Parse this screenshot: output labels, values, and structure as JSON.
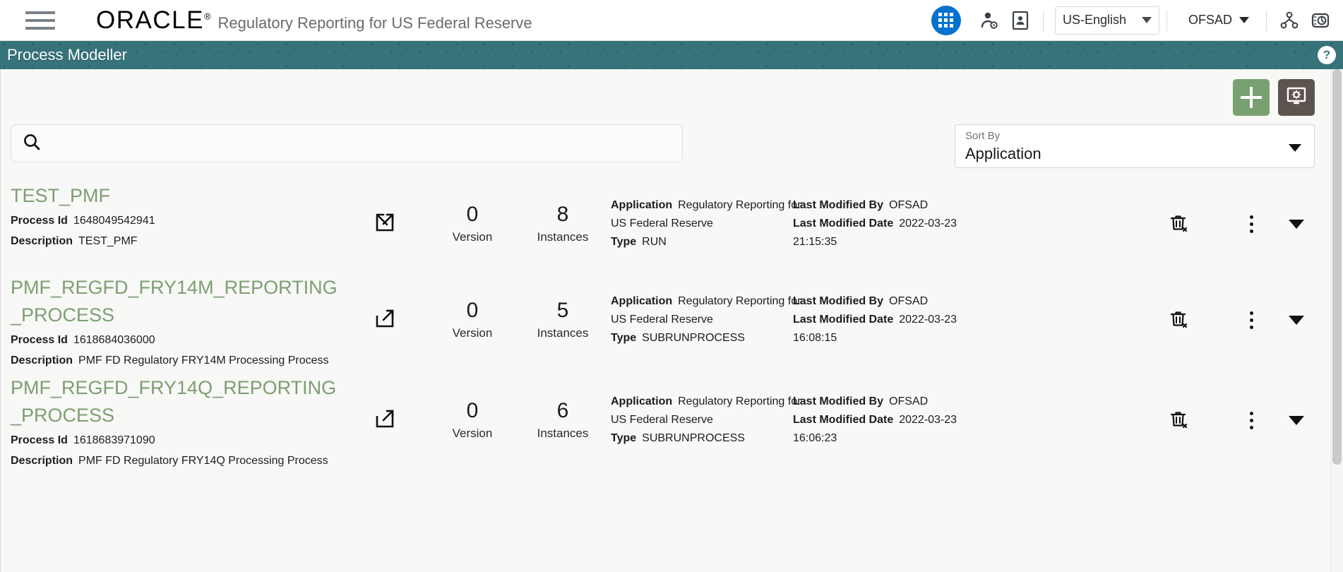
{
  "header": {
    "menu_icon": "hamburger-icon",
    "logo_text": "ORACLE",
    "logo_mark": "®",
    "app_title": "Regulatory Reporting for US Federal Reserve",
    "apps_icon": "grid-apps-icon",
    "user_settings_icon": "user-settings-icon",
    "id_card_icon": "id-card-icon",
    "language": {
      "value": "US-English",
      "caret_icon": "chevron-down-icon"
    },
    "user": {
      "value": "OFSAD",
      "caret_icon": "chevron-down-icon"
    },
    "hierarchy_icon": "org-hierarchy-icon",
    "history_icon": "time-history-icon"
  },
  "pagebar": {
    "title": "Process Modeller",
    "help_icon": "help-question-icon",
    "help_label": "?",
    "background_color": "#37737a"
  },
  "toolbar": {
    "add_button": {
      "name": "add-process-button",
      "icon": "plus-icon",
      "color": "#79a070"
    },
    "config_button": {
      "name": "configure-button",
      "icon": "monitor-gear-icon",
      "color": "#5e544f"
    }
  },
  "search": {
    "icon": "search-icon",
    "value": "",
    "placeholder": ""
  },
  "sort": {
    "label": "Sort By",
    "value": "Application",
    "caret_icon": "chevron-down-icon"
  },
  "list": {
    "field_labels": {
      "process_id": "Process Id",
      "description": "Description",
      "application": "Application",
      "type": "Type",
      "last_modified_by": "Last Modified By",
      "last_modified_date": "Last Modified Date"
    },
    "column_captions": {
      "version": "Version",
      "instances": "Instances"
    },
    "actions": {
      "open_icon": "external-link-icon",
      "delete_icon": "delete-trash-icon",
      "more_icon": "kebab-more-icon",
      "expand_icon": "chevron-down-icon"
    },
    "rows": [
      {
        "name": "TEST_PMF",
        "process_id": "1648049542941",
        "description": "TEST_PMF",
        "version": "0",
        "instances": "8",
        "application": "Regulatory Reporting for US Federal Reserve",
        "application_line1": "Regulatory Reporting for",
        "application_line2": "US Federal Reserve",
        "type": "RUN",
        "last_modified_by": "OFSAD",
        "last_modified_date": "2022-03-23",
        "last_modified_time": "21:15:35"
      },
      {
        "name": "PMF_REGFD_FRY14M_REPORTING_PROCESS",
        "process_id": "1618684036000",
        "description": "PMF FD Regulatory FRY14M Processing Process",
        "version": "0",
        "instances": "5",
        "application": "Regulatory Reporting for US Federal Reserve",
        "application_line1": "Regulatory Reporting for",
        "application_line2": "US Federal Reserve",
        "type": "SUBRUNPROCESS",
        "last_modified_by": "OFSAD",
        "last_modified_date": "2022-03-23",
        "last_modified_time": "16:08:15"
      },
      {
        "name": "PMF_REGFD_FRY14Q_REPORTING_PROCESS",
        "process_id": "1618683971090",
        "description": "PMF FD Regulatory FRY14Q Processing Process",
        "version": "0",
        "instances": "6",
        "application": "Regulatory Reporting for US Federal Reserve",
        "application_line1": "Regulatory Reporting for",
        "application_line2": "US Federal Reserve",
        "type": "SUBRUNPROCESS",
        "last_modified_by": "OFSAD",
        "last_modified_date": "2022-03-23",
        "last_modified_time": "16:06:23"
      }
    ]
  },
  "colors": {
    "accent_green": "#7d9e73",
    "teal_bar": "#37737a",
    "apps_blue": "#0572ce",
    "page_bg": "#f8f8f6"
  }
}
